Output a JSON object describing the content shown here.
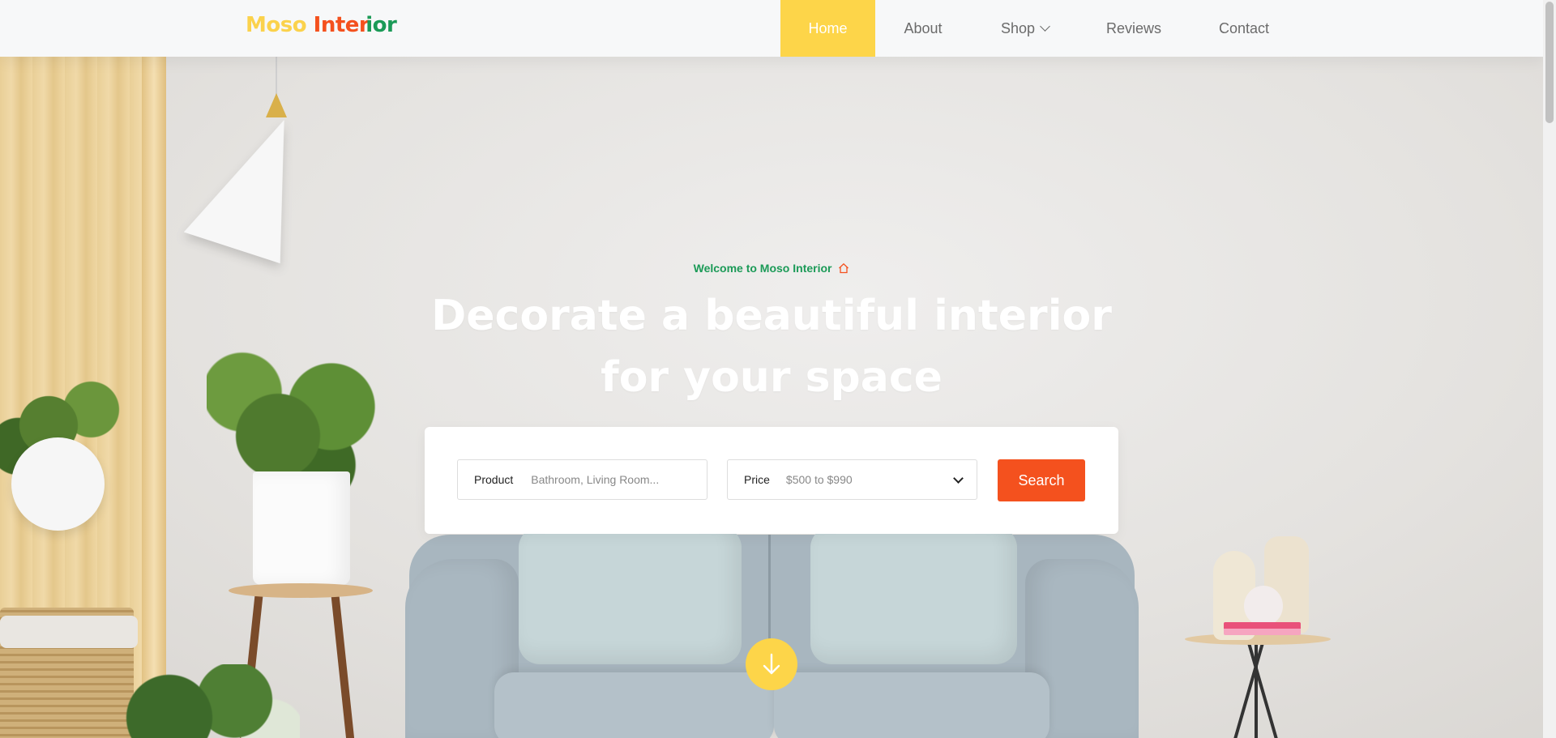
{
  "brand": {
    "logo_part1": "Moso",
    "logo_part2": "Inter",
    "logo_part3": "ior",
    "colors": {
      "yellow": "#fbd24c",
      "orange": "#f4511e",
      "green": "#1b9a57"
    }
  },
  "nav": {
    "items": [
      {
        "label": "Home",
        "active": true
      },
      {
        "label": "About",
        "active": false
      },
      {
        "label": "Shop",
        "active": false,
        "has_dropdown": true
      },
      {
        "label": "Reviews",
        "active": false
      },
      {
        "label": "Contact",
        "active": false
      }
    ]
  },
  "hero": {
    "welcome_text": "Welcome to Moso Interior",
    "welcome_icon": "home-icon",
    "headline_line1": "Decorate a beautiful interior",
    "headline_line2": "for your space",
    "scroll_icon": "arrow-down-icon"
  },
  "search": {
    "product_label": "Product",
    "product_placeholder": "Bathroom, Living Room...",
    "price_label": "Price",
    "price_value": "$500 to $990",
    "button_label": "Search"
  }
}
